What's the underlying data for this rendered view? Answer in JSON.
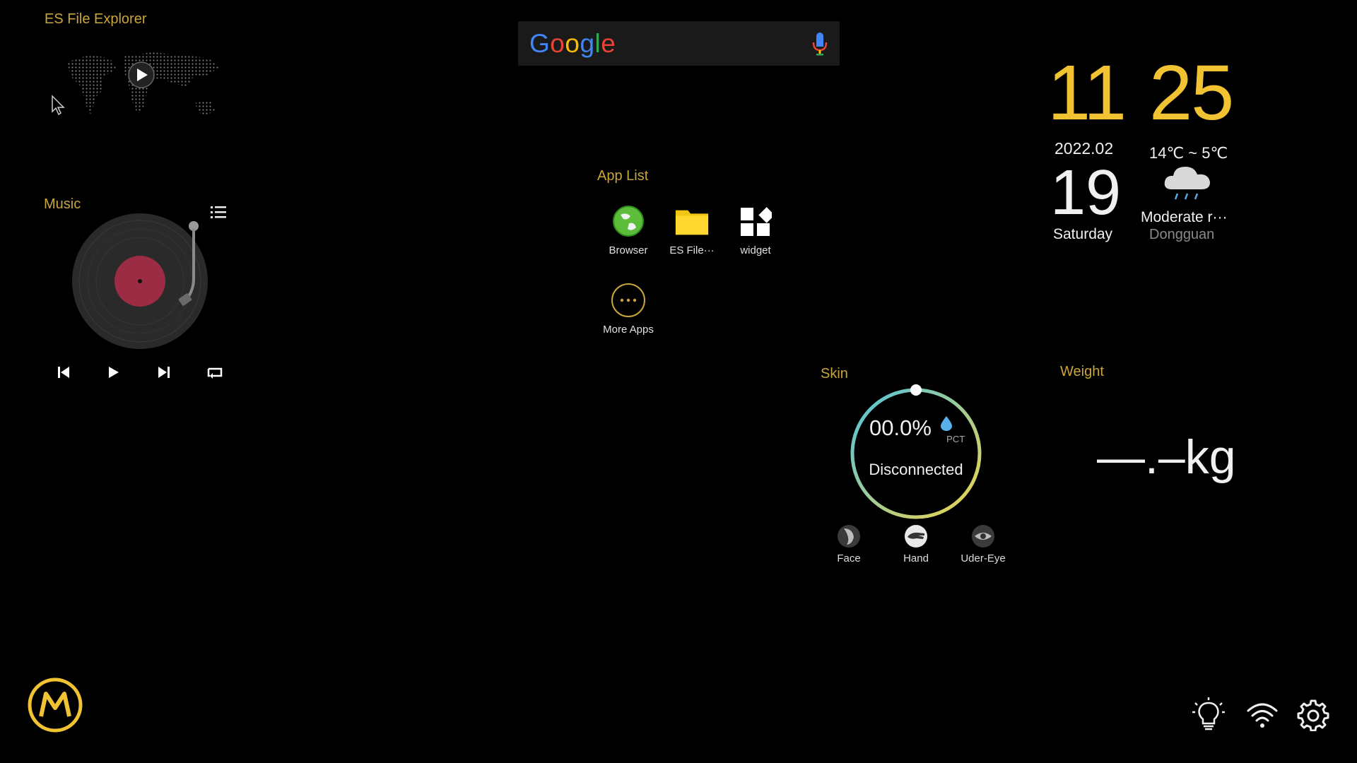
{
  "es_widget": {
    "title": "ES File Explorer"
  },
  "music": {
    "title": "Music"
  },
  "search": {
    "brand": "Google"
  },
  "app_list": {
    "title": "App List",
    "apps": [
      {
        "label": "Browser",
        "icon": "globe-icon"
      },
      {
        "label": "ES File···",
        "icon": "folder-icon"
      },
      {
        "label": "widget",
        "icon": "widget-grid-icon"
      },
      {
        "label": "More Apps",
        "icon": "more-dots-icon"
      }
    ]
  },
  "clock": {
    "hour": "11",
    "minute": "25",
    "year_month": "2022.02",
    "day": "19",
    "weekday": "Saturday"
  },
  "weather": {
    "temp_range": "14℃ ~ 5℃",
    "description": "Moderate r···",
    "city": "Dongguan",
    "icon": "rain-cloud-icon"
  },
  "skin": {
    "title": "Skin",
    "percent": "00.0%",
    "unit": "PCT",
    "status": "Disconnected",
    "modes": [
      "Face",
      "Hand",
      "Uder-Eye"
    ]
  },
  "weight": {
    "title": "Weight",
    "value": "—.–kg"
  },
  "colors": {
    "accent_gold": "#c9a53a",
    "clock_yellow": "#f1c232",
    "ring_start": "#4fc3e0",
    "ring_end": "#f1d54a"
  }
}
